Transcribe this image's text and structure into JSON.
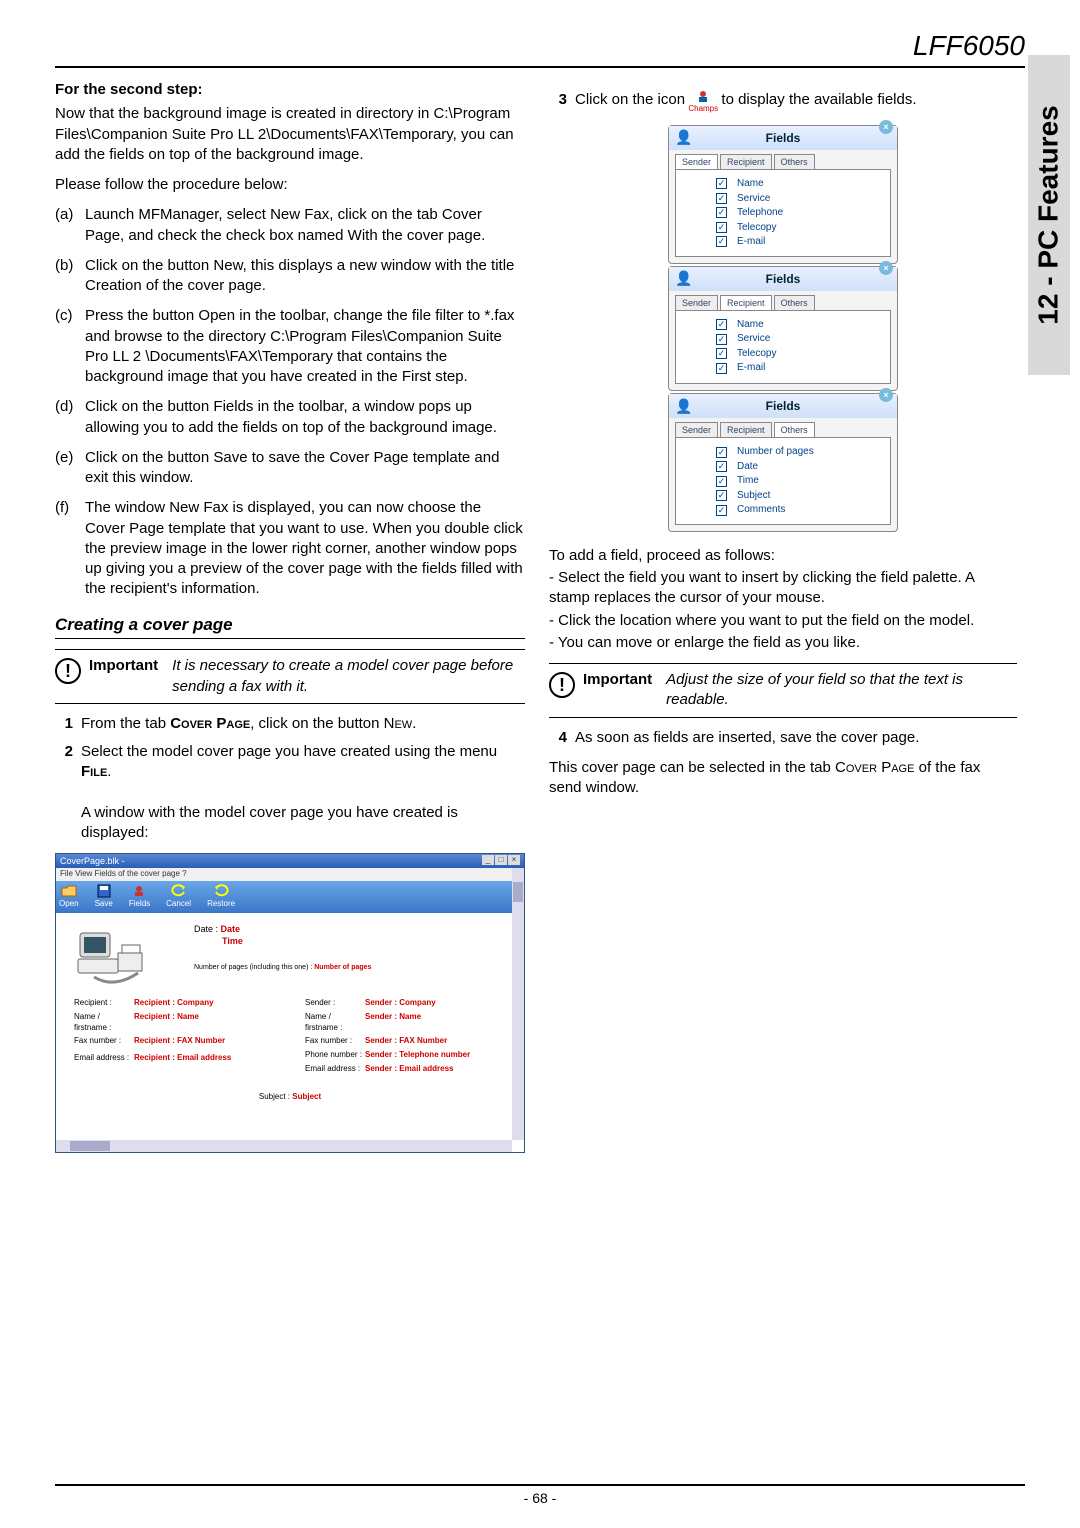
{
  "doc_model": "LFF6050",
  "side_tab": "12 - PC Features",
  "page_number": "- 68 -",
  "left": {
    "step_heading": "For the second step:",
    "intro1": "Now that the background image is created in directory in C:\\Program Files\\Companion Suite Pro LL 2\\Documents\\FAX\\Temporary, you can add the fields on top of the background image.",
    "intro2": "Please follow the procedure below:",
    "steps": {
      "a": "Launch MFManager, select New Fax, click on the tab Cover Page, and check the check box named With the cover page.",
      "b": "Click on the button New, this displays a new window with the title Creation of the cover page.",
      "c": "Press the button Open in the toolbar, change the file filter to *.fax and browse to the directory C:\\Program Files\\Companion Suite Pro LL 2 \\Documents\\FAX\\Temporary that contains the background image that you have created in the First step.",
      "d": "Click on the button Fields in the toolbar, a window pops up allowing you to add the fields on top of the background image.",
      "e": "Click on the button Save  to save the Cover Page template and exit this window.",
      "f": "The window New Fax is displayed, you can now choose the Cover Page template that you want to use. When you double click the preview image in the lower right corner, another window pops up giving you a preview of the cover page with the fields filled with the recipient's information."
    },
    "section_heading": "Creating a cover page",
    "important_label": "Important",
    "important_text": "It is necessary to create a model cover page before sending a fax with it.",
    "num1_a": "From the tab ",
    "num1_b": "Cover Page",
    "num1_c": ", click on the button N",
    "num1_d": "ew",
    "num1_e": ".",
    "num2_a": "Select the model cover page you have created using the menu ",
    "num2_b": "File",
    "num2_c": ".",
    "num2_p2": "A window with the model cover page you have created is displayed:"
  },
  "coverpage_win": {
    "title": "CoverPage.blk -",
    "menu": "File   View   Fields of the cover page   ?",
    "tools": {
      "open": "Open",
      "save": "Save",
      "fields": "Fields",
      "cancel": "Cancel",
      "restore": "Restore"
    },
    "dates": {
      "date_lbl": "Date :",
      "date_val": "Date",
      "time_val": "Time",
      "np_lbl": "Number of pages (including this one) :",
      "np_val": "Number of pages"
    },
    "recipient": {
      "company_k": "Recipient :",
      "company_v": "Recipient : Company",
      "name_k": "Name / firstname :",
      "name_v": "Recipient : Name",
      "fax_k": "Fax number :",
      "fax_v": "Recipient : FAX Number",
      "email_k": "Email address :",
      "email_v": "Recipient : Email address"
    },
    "sender": {
      "company_k": "Sender :",
      "company_v": "Sender : Company",
      "name_k": "Name / firstname :",
      "name_v": "Sender : Name",
      "fax_k": "Fax number :",
      "fax_v": "Sender : FAX Number",
      "phone_k": "Phone number :",
      "phone_v": "Sender : Telephone number",
      "email_k": "Email address :",
      "email_v": "Sender : Email address"
    },
    "subject_k": "Subject :",
    "subject_v": "Subject"
  },
  "right": {
    "step3_a": "Click on the icon ",
    "champs_label": "Champs",
    "step3_b": " to display the available fields.",
    "fields_title": "Fields",
    "tabs": {
      "sender": "Sender",
      "recipient": "Recipient",
      "others": "Others"
    },
    "sender_fields": [
      "Name",
      "Service",
      "Telephone",
      "Telecopy",
      "E-mail"
    ],
    "recipient_fields": [
      "Name",
      "Service",
      "Telecopy",
      "E-mail"
    ],
    "others_fields": [
      "Number of pages",
      "Date",
      "Time",
      "Subject",
      "Comments"
    ],
    "add_heading": "To add a field, proceed as follows:",
    "add_a": "- Select the field you want to insert by clicking the field palette. A stamp replaces the cursor of your mouse.",
    "add_b": "- Click the location where you want to put the field on the model.",
    "add_c": "- You can move or enlarge the field as you like.",
    "important_label": "Important",
    "important_text": "Adjust the size of your field so that the text is readable.",
    "num4": "As soon as fields are inserted, save the cover page.",
    "closing_a": "This cover page can be selected in the tab C",
    "closing_b": "over",
    "closing_c": " P",
    "closing_d": "age",
    "closing_e": " of the fax send window."
  }
}
